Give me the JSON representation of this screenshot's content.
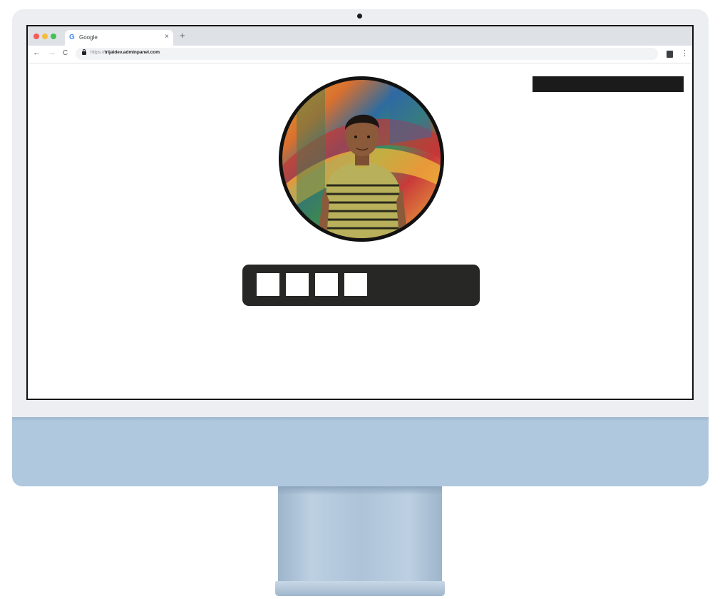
{
  "browser": {
    "tab": {
      "icon": "google-g-icon",
      "title": "Google",
      "close": "×"
    },
    "new_tab": "+",
    "nav": {
      "back": "←",
      "forward": "→",
      "reload": "C"
    },
    "url": {
      "scheme": "https://",
      "host": "trijaldev.adminpanel.com"
    },
    "menu": "⋮"
  },
  "page": {
    "avatar_alt": "profile photo",
    "pin": {
      "filled_cells": 4
    }
  },
  "colors": {
    "chin": "#b0c8de",
    "pin_box": "#272726",
    "dark_bar": "#1b1b1b"
  }
}
